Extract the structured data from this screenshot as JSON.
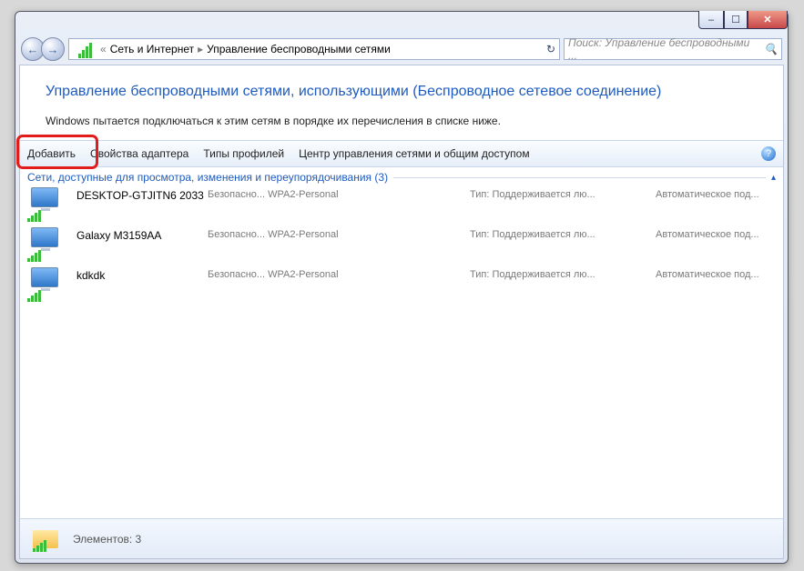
{
  "window": {
    "min": "–",
    "max": "☐",
    "close": "✕"
  },
  "nav": {
    "back": "←",
    "forward": "→"
  },
  "address": {
    "prefix": "«",
    "crumb1": "Сеть и Интернет",
    "sep": "▸",
    "crumb2": "Управление беспроводными сетями",
    "refresh": "↻"
  },
  "search": {
    "placeholder": "Поиск: Управление беспроводными ...",
    "mag": "🔍"
  },
  "page": {
    "title": "Управление беспроводными сетями, использующими (Беспроводное сетевое соединение)",
    "desc": "Windows пытается подключаться к этим сетям в порядке их перечисления в списке ниже."
  },
  "toolbar": {
    "add": "Добавить",
    "adapter": "Свойства адаптера",
    "profiles": "Типы профилей",
    "center": "Центр управления сетями и общим доступом",
    "help": "?"
  },
  "group": {
    "header": "Сети, доступные для просмотра, изменения и переупорядочивания (3)",
    "chev": "▴"
  },
  "labels": {
    "security": "Безопасно...",
    "type": "Тип:",
    "supported": "Поддерживается лю...",
    "auto": "Автоматическое под..."
  },
  "networks": [
    {
      "name": "DESKTOP-GTJITN6 2033",
      "security": "WPA2-Personal"
    },
    {
      "name": "Galaxy M3159AA",
      "security": "WPA2-Personal"
    },
    {
      "name": "kdkdk",
      "security": "WPA2-Personal"
    }
  ],
  "status": {
    "elements": "Элементов: 3"
  }
}
